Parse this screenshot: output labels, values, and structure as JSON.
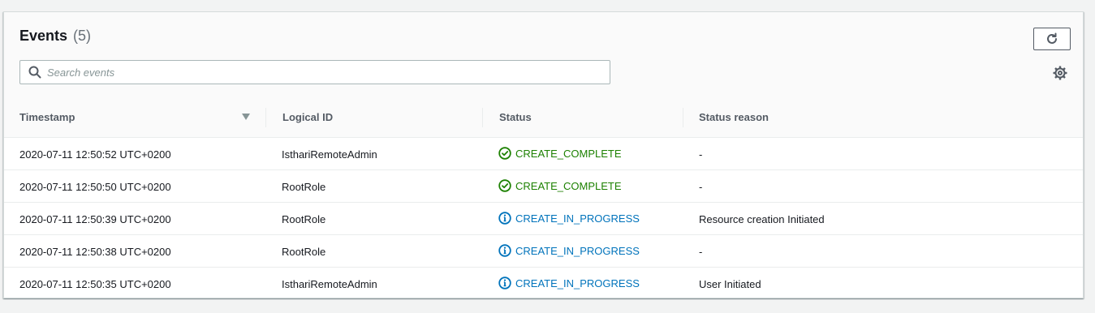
{
  "events": {
    "title": "Events",
    "count": "(5)",
    "search_placeholder": "Search events",
    "columns": [
      "Timestamp",
      "Logical ID",
      "Status",
      "Status reason"
    ],
    "rows": [
      {
        "timestamp": "2020-07-11 12:50:52 UTC+0200",
        "logical_id": "IsthariRemoteAdmin",
        "status": "CREATE_COMPLETE",
        "status_type": "complete",
        "reason": "-"
      },
      {
        "timestamp": "2020-07-11 12:50:50 UTC+0200",
        "logical_id": "RootRole",
        "status": "CREATE_COMPLETE",
        "status_type": "complete",
        "reason": "-"
      },
      {
        "timestamp": "2020-07-11 12:50:39 UTC+0200",
        "logical_id": "RootRole",
        "status": "CREATE_IN_PROGRESS",
        "status_type": "progress",
        "reason": "Resource creation Initiated"
      },
      {
        "timestamp": "2020-07-11 12:50:38 UTC+0200",
        "logical_id": "RootRole",
        "status": "CREATE_IN_PROGRESS",
        "status_type": "progress",
        "reason": "-"
      },
      {
        "timestamp": "2020-07-11 12:50:35 UTC+0200",
        "logical_id": "IsthariRemoteAdmin",
        "status": "CREATE_IN_PROGRESS",
        "status_type": "progress",
        "reason": "User Initiated"
      }
    ]
  },
  "icons": {
    "refresh": "refresh-icon",
    "search": "search-icon",
    "settings": "gear-icon",
    "sort": "sort-descending-icon",
    "success": "check-circle-icon",
    "info": "info-circle-icon"
  },
  "colors": {
    "success": "#1d8102",
    "in_progress": "#0073bb"
  }
}
